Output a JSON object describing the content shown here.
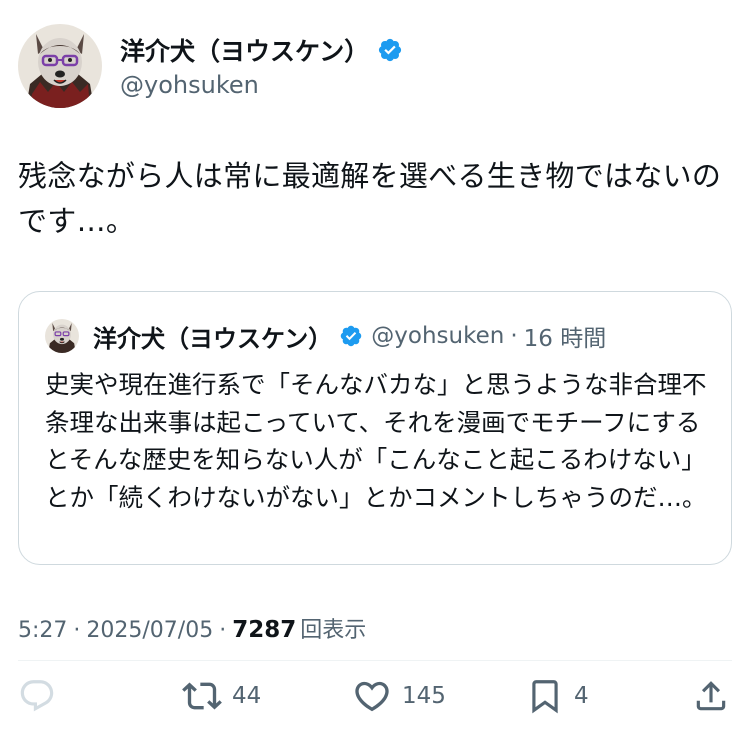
{
  "author": {
    "display_name": "洋介犬（ヨウスケン）",
    "handle": "@yohsuken"
  },
  "tweet": {
    "text": "残念ながら人は常に最適解を選べる生き物ではないのです…。"
  },
  "quoted_tweet": {
    "display_name": "洋介犬（ヨウスケン）",
    "handle": "@yohsuken",
    "separator": "·",
    "time": "16 時間",
    "text": "史実や現在進行系で「そんなバカな」と思うような非合理不条理な出来事は起こっていて、それを漫画でモチーフにするとそんな歴史を知らない人が「こんなこと起こるわけない」とか「続くわけないがない」とかコメントしちゃうのだ…。"
  },
  "meta": {
    "time": "5:27",
    "separator": "·",
    "date": "2025/07/05",
    "separator2": "·",
    "views": "7287",
    "views_label": "回表示"
  },
  "actions": {
    "reply_count": "",
    "retweet_count": "44",
    "like_count": "145",
    "bookmark_count": "4"
  },
  "icons": {
    "verified": "verified-badge-icon",
    "reply": "reply-icon",
    "retweet": "retweet-icon",
    "like": "heart-icon",
    "bookmark": "bookmark-icon",
    "share": "share-icon"
  },
  "colors": {
    "verified_blue": "#1d9bf0",
    "text": "#0f1419",
    "secondary": "#536471",
    "border": "#cfd9de"
  }
}
